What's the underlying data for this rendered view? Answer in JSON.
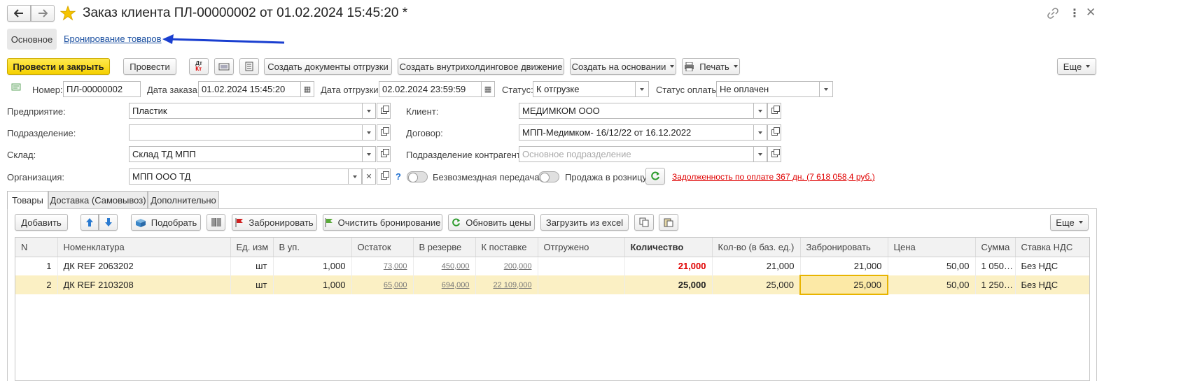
{
  "title": "Заказ клиента ПЛ-00000002 от 01.02.2024 15:45:20 *",
  "nav_tabs": [
    "Основное",
    "Бронирование товаров"
  ],
  "toolbar": {
    "post_close": "Провести и закрыть",
    "post": "Провести",
    "create_shipping": "Создать документы отгрузки",
    "create_intra": "Создать внутрихолдинговое движение",
    "create_basis": "Создать на основании",
    "print": "Печать",
    "more": "Еще"
  },
  "header": {
    "number_label": "Номер:",
    "number": "ПЛ-00000002",
    "order_date_label": "Дата заказа:",
    "order_date": "01.02.2024 15:45:20",
    "ship_date_label": "Дата отгрузки:",
    "ship_date": "02.02.2024 23:59:59",
    "status_label": "Статус:",
    "status": "К отгрузке",
    "pay_status_label": "Статус оплаты:",
    "pay_status": "Не оплачен"
  },
  "fields": {
    "enterprise_label": "Предприятие:",
    "enterprise": "Пластик",
    "division_label": "Подразделение:",
    "division": "",
    "warehouse_label": "Склад:",
    "warehouse": "Склад ТД МПП",
    "org_label": "Организация:",
    "org": "МПП ООО ТД",
    "client_label": "Клиент:",
    "client": "МЕДИМКОМ ООО",
    "contract_label": "Договор:",
    "contract": "МПП-Медимком- 16/12/22 от 16.12.2022",
    "cp_division_label": "Подразделение контрагента:",
    "cp_division_placeholder": "Основное подразделение",
    "free_transfer": "Безвозмездная передача",
    "retail_sale": "Продажа в розницу",
    "debt_text": "Задолженность по оплате 367 дн. (7 618 058,4 руб.)",
    "help": "?"
  },
  "tabs": [
    "Товары",
    "Доставка (Самовывоз)",
    "Дополнительно"
  ],
  "table_toolbar": {
    "add": "Добавить",
    "pick": "Подобрать",
    "reserve": "Забронировать",
    "clear_reserve": "Очистить бронирование",
    "update_prices": "Обновить цены",
    "load_excel": "Загрузить из excel",
    "more": "Еще"
  },
  "table": {
    "columns": [
      "N",
      "Номенклатура",
      "Ед. изм",
      "В уп.",
      "Остаток",
      "В резерве",
      "К поставке",
      "Отгружено",
      "Количество",
      "Кол-во (в баз. ед.)",
      "Забронировать",
      "Цена",
      "Сумма",
      "Ставка НДС"
    ],
    "rows": [
      {
        "n": "1",
        "name": "ДК REF 2063202",
        "unit": "шт",
        "pack": "1,000",
        "stock": "73,000",
        "reserved": "450,000",
        "to_supply": "200,000",
        "shipped": "",
        "qty": "21,000",
        "qty_base": "21,000",
        "book": "21,000",
        "price": "50,00",
        "sum": "1 050…",
        "vat": "Без НДС"
      },
      {
        "n": "2",
        "name": "ДК REF 2103208",
        "unit": "шт",
        "pack": "1,000",
        "stock": "65,000",
        "reserved": "694,000",
        "to_supply": "22 109,000",
        "shipped": "",
        "qty": "25,000",
        "qty_base": "25,000",
        "book": "25,000",
        "price": "50,00",
        "sum": "1 250…",
        "vat": "Без НДС"
      }
    ]
  },
  "colors": {
    "accent_yellow": "#f5d000",
    "debt_red": "#e00000",
    "arrow_blue": "#1a3fd0",
    "selected_row": "#fbf0c4"
  }
}
